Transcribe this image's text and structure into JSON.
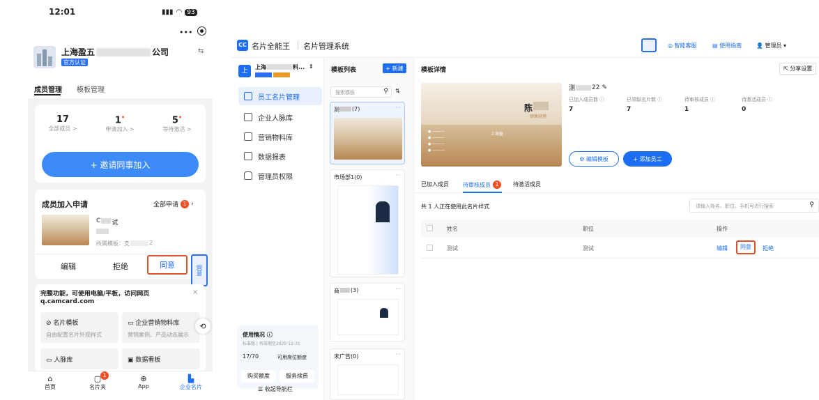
{
  "mobile": {
    "status_time": "12:01",
    "battery": "93",
    "company_name": "上海盈五",
    "company_name_tail": "公司",
    "verified_badge": "官方认证",
    "tabs": [
      "成员管理",
      "模板管理"
    ],
    "stats": [
      {
        "value": "17",
        "label": "全部成员 >"
      },
      {
        "value": "1",
        "label": "申请加入 >"
      },
      {
        "value": "5",
        "label": "等待激活 >"
      }
    ],
    "invite_button": "+ 邀请同事加入",
    "apply_title": "成员加入申请",
    "apply_all": "全部申请",
    "apply_all_count": "1",
    "applicant_name": "C",
    "applicant_name_tail": "试",
    "applicant_template": "所属模板：支",
    "applicant_template_tail": "2",
    "actions": {
      "edit": "编辑",
      "reject": "拒绝",
      "agree": "同意"
    },
    "tooltip_text": "同意",
    "promo_title": "完整功能，可使用电脑/平板，访问网页",
    "promo_url": "q.camcard.com",
    "grid": [
      {
        "icon": "card-template-icon",
        "title": "名片模板",
        "desc": "自由配置名片外观样式"
      },
      {
        "icon": "marketing-icon",
        "title": "企业营销物料库",
        "desc": "营销案例、产品动态展示"
      },
      {
        "icon": "contacts-icon",
        "title": "人脉库",
        "desc": ""
      },
      {
        "icon": "dashboard-icon",
        "title": "数据看板",
        "desc": ""
      }
    ],
    "bottom_nav": [
      {
        "icon": "home-icon",
        "label": "首页",
        "badge": ""
      },
      {
        "icon": "card-holder-icon",
        "label": "名片夹",
        "badge": "1"
      },
      {
        "icon": "app-download-icon",
        "label": "App",
        "badge": ""
      },
      {
        "icon": "enterprise-card-icon",
        "label": "企业名片",
        "badge": ""
      }
    ]
  },
  "desktop": {
    "logo": "CC",
    "app_name": "名片全能王",
    "system_name": "名片管理系统",
    "header_links": [
      "智能客服",
      "使用指南",
      "管理员"
    ],
    "company_short": "上海",
    "company_tail": "料...",
    "side_items": [
      "员工名片管理",
      "企业人脉库",
      "营销物料库",
      "数据报表",
      "管理员权限"
    ],
    "usage": {
      "title": "使用情况",
      "edition": "标准版 | 有效期至2025-12-31",
      "used": "17/70",
      "quota_label": "可用席位额度",
      "buy": "购买额度",
      "renew": "服务续费"
    },
    "collapse_nav": "收起导航栏",
    "tpl_list_title": "模板列表",
    "new_button": "+ 新建",
    "search_placeholder": "搜索模板",
    "templates": [
      {
        "name": "测",
        "tail": "(7)"
      },
      {
        "name": "市场部1(0)",
        "tail": ""
      },
      {
        "name": "商",
        "tail": "(3)"
      },
      {
        "name": "未广告(0)",
        "tail": ""
      }
    ],
    "detail_title": "模板详情",
    "share_settings": "分享设置",
    "preview_name": "陈",
    "preview_title": "销售经理",
    "preview_company": "上海盈",
    "tpl_name": "测",
    "tpl_name_tail": "22",
    "stats": [
      {
        "label": "已加入成员数",
        "value": "7"
      },
      {
        "label": "已领取名片数",
        "value": "7"
      },
      {
        "label": "待审核成员",
        "value": "1"
      },
      {
        "label": "待激活成员",
        "value": "0"
      }
    ],
    "edit_template": "编辑模板",
    "add_employee": "+ 添加员工",
    "tabs": [
      "已加入成员",
      "待审核成员",
      "待激活成员"
    ],
    "pending_badge": "1",
    "usage_note": "共 1 人正在使用此名片样式",
    "member_search_placeholder": "请输入姓名、职位、手机号进行搜索",
    "table_headers": [
      "姓名",
      "职位",
      "操作"
    ],
    "row": {
      "name": "测试",
      "position": "测试",
      "edit": "编辑",
      "agree": "同意",
      "reject": "拒绝"
    }
  }
}
